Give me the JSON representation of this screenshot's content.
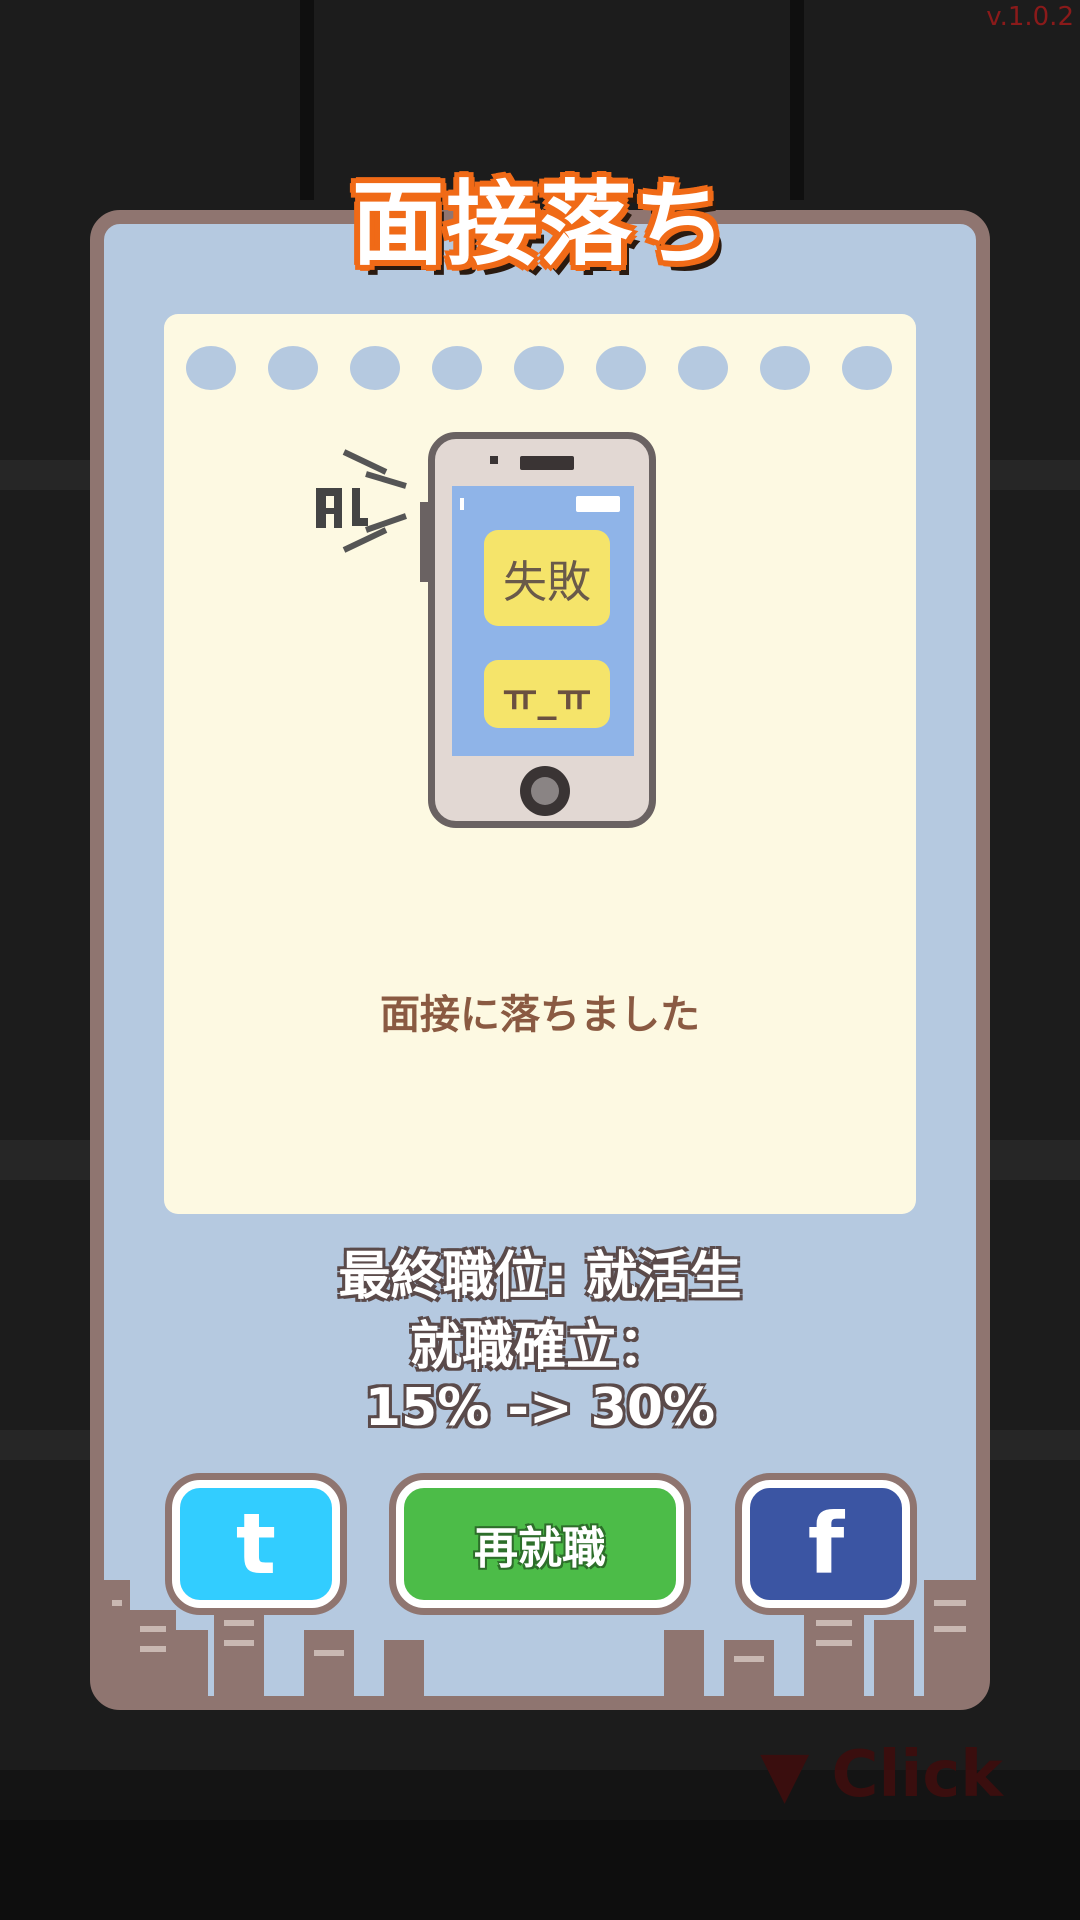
{
  "version": "v.1.0.2",
  "title": "面接落ち",
  "phone": {
    "ring_icon": "phone-ringing-icon",
    "bubble_top": "失敗",
    "bubble_bottom": "ㅠ_ㅠ"
  },
  "message": "面接に落ちました",
  "stats": {
    "final_position": "最終職位: 就活生",
    "employment_label": "就職確立：",
    "employment_change": "15% -> 30%"
  },
  "buttons": {
    "twitter_icon": "twitter-icon",
    "retry_label": "再就職",
    "facebook_icon": "facebook-icon"
  },
  "click_hint": "▼ Click",
  "colors": {
    "card_bg": "#b5c9e0",
    "card_border": "#8f7570",
    "title_outline": "#f06a17",
    "twitter": "#32cdff",
    "facebook": "#3b55a3",
    "retry": "#4cbc48"
  }
}
